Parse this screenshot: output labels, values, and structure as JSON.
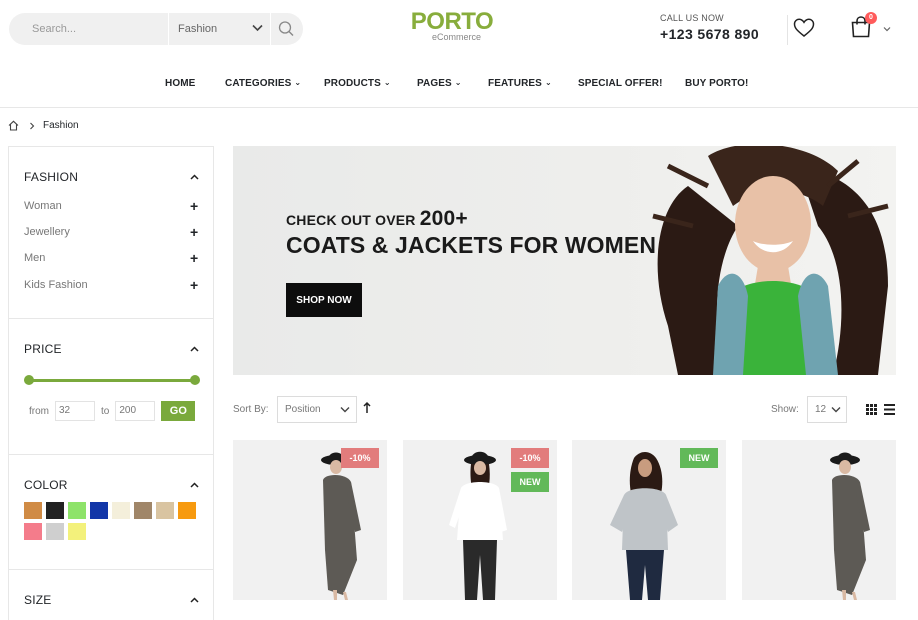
{
  "header": {
    "search_placeholder": "Search...",
    "search_category": "Fashion",
    "logo_main": "PORTO",
    "logo_sub": "eCommerce",
    "call_label": "CALL US NOW",
    "call_number": "+123 5678 890",
    "cart_count": "0"
  },
  "nav": {
    "items": [
      {
        "label": "HOME",
        "caret": ""
      },
      {
        "label": "CATEGORIES",
        "caret": "⌄"
      },
      {
        "label": "PRODUCTS",
        "caret": "⌄"
      },
      {
        "label": "PAGES",
        "caret": "⌄"
      },
      {
        "label": "FEATURES",
        "caret": "⌄"
      },
      {
        "label": "SPECIAL OFFER!",
        "caret": ""
      },
      {
        "label": "BUY PORTO!",
        "caret": ""
      }
    ]
  },
  "breadcrumb": {
    "current": "Fashion"
  },
  "sidebar": {
    "fashion": {
      "title": "FASHION",
      "items": [
        "Woman",
        "Jewellery",
        "Men",
        "Kids Fashion"
      ]
    },
    "price": {
      "title": "PRICE",
      "from_label": "from",
      "from_value": "32",
      "to_label": "to",
      "to_value": "200",
      "go_label": "GO"
    },
    "color": {
      "title": "COLOR",
      "swatches": [
        "#d08b45",
        "#222222",
        "#8ee36a",
        "#1236a8",
        "#f4efdb",
        "#a08669",
        "#d9c4a1",
        "#f79a0f",
        "#f47c8b",
        "#cfcfcf",
        "#f3f17b"
      ]
    },
    "size": {
      "title": "SIZE"
    }
  },
  "banner": {
    "line1_prefix": "CHECK OUT OVER ",
    "line1_number": "200+",
    "line2": "COATS & JACKETS FOR WOMEN",
    "button": "SHOP NOW"
  },
  "toolbar": {
    "sort_label": "Sort By:",
    "sort_value": "Position",
    "show_label": "Show:",
    "show_value": "12"
  },
  "products": [
    {
      "badges": [
        {
          "text": "-10%",
          "type": "sale"
        }
      ]
    },
    {
      "badges": [
        {
          "text": "-10%",
          "type": "sale"
        },
        {
          "text": "NEW",
          "type": "new"
        }
      ]
    },
    {
      "badges": [
        {
          "text": "NEW",
          "type": "new"
        }
      ]
    },
    {
      "badges": []
    }
  ],
  "colors": {
    "accent": "#7aa93c",
    "logo": "#88ad3c",
    "sale_badge": "#e27c7c",
    "new_badge": "#62b959",
    "cart_badge": "#ff5b5b"
  }
}
